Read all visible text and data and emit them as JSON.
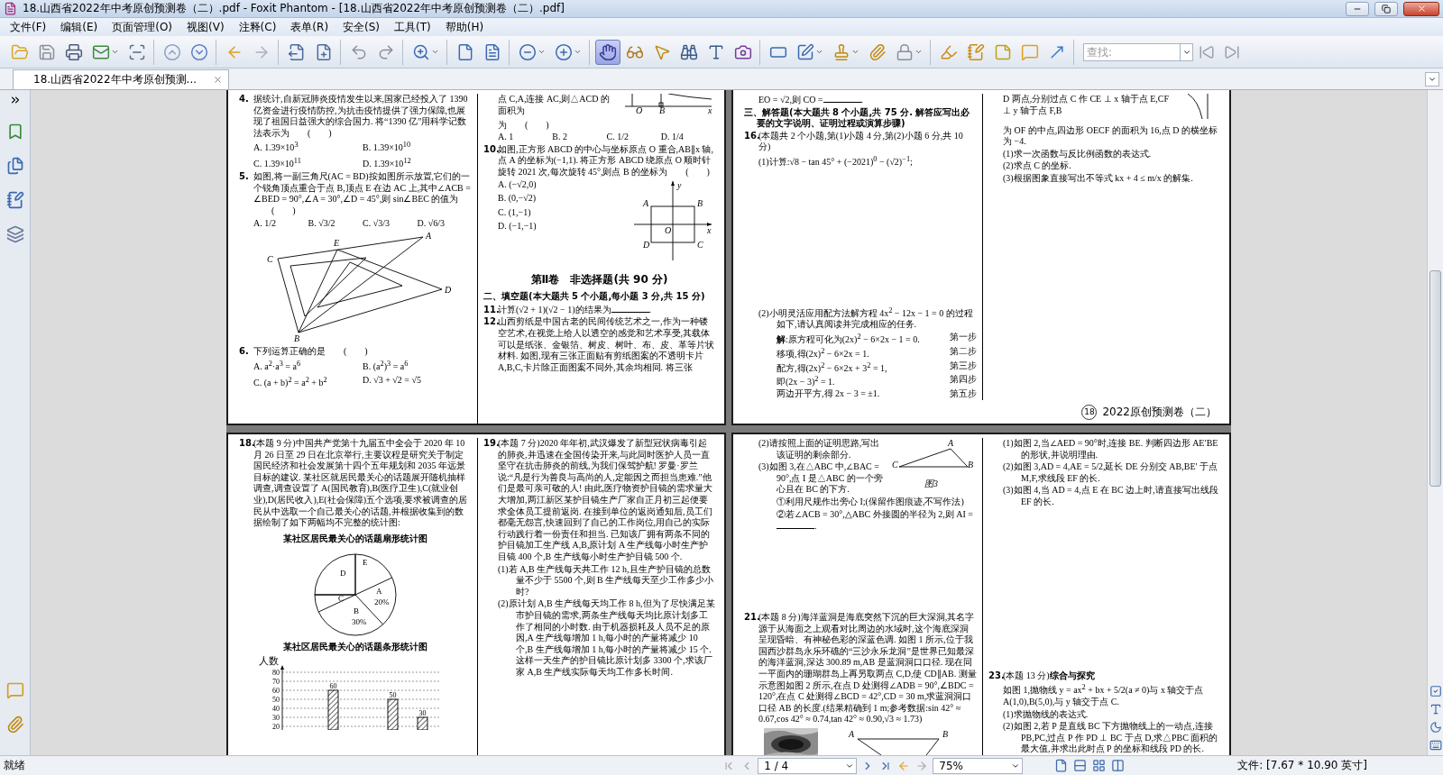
{
  "window": {
    "title": "18.山西省2022年中考原创预测卷（二）.pdf - Foxit Phantom - [18.山西省2022年中考原创预测卷（二）.pdf]"
  },
  "menu": [
    "文件(F)",
    "编辑(E)",
    "页面管理(O)",
    "视图(V)",
    "注释(C)",
    "表单(R)",
    "安全(S)",
    "工具(T)",
    "帮助(H)"
  ],
  "toolbar": [
    [
      {
        "kind": "open",
        "selected": false,
        "menu": false
      },
      {
        "kind": "save",
        "selected": false,
        "menu": false
      },
      {
        "kind": "print",
        "selected": false,
        "menu": false
      },
      {
        "kind": "email",
        "selected": false,
        "menu": true
      },
      {
        "kind": "scan",
        "selected": false,
        "menu": false
      }
    ],
    [
      {
        "kind": "up",
        "selected": false,
        "menu": false
      },
      {
        "kind": "down",
        "selected": false,
        "menu": false
      }
    ],
    [
      {
        "kind": "back",
        "selected": false,
        "menu": false
      },
      {
        "kind": "forward",
        "selected": false,
        "menu": false
      }
    ],
    [
      {
        "kind": "extract",
        "selected": false,
        "menu": false
      },
      {
        "kind": "insert",
        "selected": false,
        "menu": false
      }
    ],
    [
      {
        "kind": "undo",
        "selected": false,
        "menu": false
      },
      {
        "kind": "redo",
        "selected": false,
        "menu": false
      }
    ],
    [
      {
        "kind": "zoom",
        "selected": false,
        "menu": true
      }
    ],
    [
      {
        "kind": "fitpage",
        "selected": false,
        "menu": false
      },
      {
        "kind": "fitwidth",
        "selected": false,
        "menu": false
      }
    ],
    [
      {
        "kind": "zoomout",
        "selected": false,
        "menu": true
      },
      {
        "kind": "zoomin",
        "selected": false,
        "menu": true
      }
    ],
    [
      {
        "kind": "hand",
        "selected": true,
        "menu": false
      },
      {
        "kind": "glasses",
        "selected": false,
        "menu": false
      },
      {
        "kind": "pointer",
        "selected": false,
        "menu": false
      },
      {
        "kind": "binoculars",
        "selected": false,
        "menu": false
      },
      {
        "kind": "typewriter",
        "selected": false,
        "menu": false
      },
      {
        "kind": "camera",
        "selected": false,
        "menu": false
      }
    ],
    [
      {
        "kind": "frame",
        "selected": false,
        "menu": false
      },
      {
        "kind": "edit",
        "selected": false,
        "menu": true
      },
      {
        "kind": "stamp",
        "selected": false,
        "menu": true
      },
      {
        "kind": "attach",
        "selected": false,
        "menu": false
      },
      {
        "kind": "lock",
        "selected": false,
        "menu": true
      }
    ],
    [
      {
        "kind": "highlight",
        "selected": false,
        "menu": false
      },
      {
        "kind": "notebook",
        "selected": false,
        "menu": false
      },
      {
        "kind": "textbox",
        "selected": false,
        "menu": false
      },
      {
        "kind": "comment",
        "selected": false,
        "menu": false
      },
      {
        "kind": "arrow",
        "selected": false,
        "menu": false
      }
    ]
  ],
  "search": {
    "placeholder": "查找:"
  },
  "tabs": [
    {
      "label": "18.山西省2022年中考原创预测...",
      "selected": true
    }
  ],
  "pages": [
    {
      "columns": [
        {
          "blocks": [
            {
              "kind": "question",
              "number": "4.",
              "text": "据统计,自新冠肺炎疫情发生以来,国家已经投入了 1390 亿资金进行疫情防控,为抗击疫情提供了强力保障,也展现了祖国日益强大的综合国力. 将“1390 亿”用科学记数法表示为",
              "bracket": "(　　)"
            },
            {
              "kind": "options-grid",
              "items": [
                "A. 1.39×10$^{3}$",
                "B. 1.39×10$^{10}$",
                "C. 1.39×10$^{11}$",
                "D. 1.39×10$^{12}$"
              ]
            },
            {
              "kind": "question",
              "number": "5.",
              "text": "如图,将一副三角尺(AC = BD)按如图所示放置,它们的一个锐角顶点重合于点 B,顶点 E 在边 AC 上,其中∠ACB = ∠BED = 90°,∠A = 30°,∠D = 45°,则 sin∠BEC 的值为",
              "bracket": "(　　)"
            },
            {
              "kind": "options-row",
              "items": [
                "A. 1/2",
                "B. √3/2",
                "C. √3/3",
                "D. √6/3"
              ]
            },
            {
              "kind": "set-squares",
              "labels": [
                "A",
                "E",
                "C",
                "D",
                "B"
              ]
            },
            {
              "kind": "question",
              "number": "6.",
              "text": "下列运算正确的是",
              "bracket": "(　　)"
            },
            {
              "kind": "options-grid",
              "items": [
                "A. a$^{2}$·a$^{3}$ = a$^{6}$",
                "B. (a$^{2}$)$^{3}$ = a$^{6}$",
                "C. (a + b)$^{2}$ = a$^{2}$ + b$^{2}$",
                "D. √3 + √2 = √5"
              ]
            }
          ]
        },
        {
          "blocks": [
            {
              "kind": "figure-beside",
              "figure": {
                "kind": "axis-fragment",
                "labels": [
                  "O",
                  "B",
                  "x"
                ]
              },
              "blocks": [
                {
                  "kind": "text",
                  "text": "点 C,A,连接 AC,则△ACD 的面积为"
                }
              ]
            },
            {
              "kind": "text",
              "text": "为",
              "bracket": "(　　)"
            },
            {
              "kind": "options-row",
              "items": [
                "A. 1",
                "B. 2",
                "C. 1/2",
                "D. 1/4"
              ]
            },
            {
              "kind": "question",
              "number": "10.",
              "text": "如图,正方形 ABCD 的中心与坐标原点 O 重合,AB∥x 轴,点 A 的坐标为(−1,1). 将正方形 ABCD 绕原点 O 顺时针旋转 2021 次,每次旋转 45°,则点 B 的坐标为",
              "bracket": "(　　)"
            },
            {
              "kind": "options-figure",
              "items": [
                "A. (−√2,0)",
                "B. (0,−√2)",
                "C. (1,−1)",
                "D. (−1,−1)"
              ],
              "figure": {
                "kind": "square-axes",
                "labels": [
                  "y",
                  "A",
                  "B",
                  "O",
                  "x",
                  "D",
                  "C"
                ]
              }
            },
            {
              "kind": "part-title",
              "text": "第Ⅱ卷　非选择题(共 90 分)"
            },
            {
              "kind": "section",
              "text": "二、填空题(本大题共 5 个小题,每小题 3 分,共 15 分)"
            },
            {
              "kind": "question",
              "number": "11.",
              "text": "计算(√2 + 1)(√2 − 1)的结果为",
              "blank": true,
              "after": "."
            },
            {
              "kind": "question",
              "number": "12.",
              "text": "山西剪纸是中国古老的民间传统艺术之一,作为一种镂空艺术,在视觉上给人以透空的感觉和艺术享受,其载体可以是纸张、金银箔、树皮、树叶、布、皮、革等片状材料. 如图,现有三张正面贴有剪纸图案的不透明卡片 A,B,C,卡片除正面图案不同外,其余均相同. 将三张"
            }
          ]
        }
      ]
    },
    {
      "columns": [
        {
          "blocks": [
            {
              "kind": "text",
              "text": "EO = √2,则 CO =",
              "blank": true,
              "after": "."
            },
            {
              "kind": "section",
              "text": "三、解答题(本大题共 8 个小题,共 75 分. 解答应写出必要的文字说明、证明过程或演算步骤)"
            },
            {
              "kind": "question",
              "number": "16.",
              "text": "(本题共 2 个小题,第(1)小题 4 分,第(2)小题 6 分,共 10 分)"
            },
            {
              "kind": "sub",
              "text": "(1)计算:√8 − tan 45° + (−2021)$^{0}$ − (√2)$^{−1}$;",
              "answer_space": true
            },
            {
              "kind": "sub",
              "text": "(2)小明灵活应用配方法解方程 4x$^{2}$ − 12x − 1 = 0 的过程如下,请认真阅读并完成相应的任务."
            },
            {
              "kind": "steps",
              "items": [
                {
                  "text": "**解**:原方程可化为(2x)$^{2}$ − 6×2x − 1 = 0.",
                  "step": "第一步"
                },
                {
                  "text": "移项,得(2x)$^{2}$ − 6×2x = 1.",
                  "step": "第二步"
                },
                {
                  "text": "配方,得(2x)$^{2}$ − 6×2x + 3$^{2}$ = 1,",
                  "step": "第三步"
                },
                {
                  "text": "即(2x − 3)$^{2}$ = 1.",
                  "step": "第四步"
                },
                {
                  "text": "两边开平方,得 2x − 3 = ±1.",
                  "step": "第五步"
                }
              ]
            }
          ]
        },
        {
          "blocks": [
            {
              "kind": "figure-beside",
              "figure": {
                "kind": "curve-fragment"
              },
              "blocks": [
                {
                  "kind": "text",
                  "text": "D 两点,分别过点 C 作 CE ⊥ x 轴于点 E,CF ⊥ y 轴于点 F,B"
                }
              ]
            },
            {
              "kind": "text",
              "text": "为 OF 的中点,四边形 OECF 的面积为 16,点 D 的横坐标为 −4."
            },
            {
              "kind": "text",
              "text": "(1)求一次函数与反比例函数的表达式."
            },
            {
              "kind": "text",
              "text": "(2)求点 C 的坐标."
            },
            {
              "kind": "text",
              "text": "(3)根据图象直接写出不等式 kx + 4 ≤ m/x 的解集."
            }
          ]
        }
      ],
      "footer": {
        "number": "18",
        "title": "2022原创预测卷（二）"
      }
    },
    {
      "columns": [
        {
          "blocks": [
            {
              "kind": "question",
              "number": "18.",
              "text": "(本题 9 分)中国共产党第十九届五中全会于 2020 年 10 月 26 日至 29 日在北京举行,主要议程是研究关于制定国民经济和社会发展第十四个五年规划和 2035 年远景目标的建议. 某社区就居民最关心的话题展开随机抽样调查,调查设置了 A(国民教育),B(医疗卫生),C(就业创业),D(居民收入),E(社会保障)五个选项,要求被调查的居民从中选取一个自己最关心的话题,并根据收集到的数据绘制了如下两幅均不完整的统计图:"
            },
            {
              "kind": "caption",
              "text": "某社区居民最关心的话题扇形统计图"
            },
            {
              "kind": "pie",
              "labels": [
                "E",
                "D",
                "A",
                "C",
                "20%",
                "B",
                "30%"
              ]
            },
            {
              "kind": "chart",
              "chart_data": {
                "type": "bar",
                "title": "某社区居民最关心的话题条形统计图",
                "ylabel": "人数",
                "values": [
                  null,
                  60,
                  null,
                  50,
                  30
                ],
                "ylim": [
                  20,
                  80
                ],
                "yticks": [
                  20,
                  30,
                  40,
                  50,
                  60,
                  70,
                  80
                ],
                "grid": true,
                "data_labels": true
              }
            }
          ]
        },
        {
          "blocks": [
            {
              "kind": "question",
              "number": "19.",
              "text": "(本题 7 分)2020 年年初,武汉爆发了新型冠状病毒引起的肺炎,并迅速在全国传染开来,与此同时医护人员一直坚守在抗击肺炎的前线,为我们保驾护航! 罗曼·罗兰说:“凡是行为善良与高尚的人,定能因之而担当患难.”他们是最可亲可敬的人! 由此,医疗物资护目镜的需求量大大增加,两江新区某护目镜生产厂家自正月初三起便要求全体员工提前返岗. 在接到单位的返岗通知后,员工们都毫无怨言,快速回到了自己的工作岗位,用自己的实际行动践行着一份责任和担当. 已知该厂拥有两条不同的护目镜加工生产线 A,B,原计划 A 生产线每小时生产护目镜 400 个,B 生产线每小时生产护目镜 500 个."
            },
            {
              "kind": "sub",
              "text": "(1)若 A,B 生产线每天共工作 12 h,且生产护目镜的总数量不少于 5500 个,则 B 生产线每天至少工作多少小时?"
            },
            {
              "kind": "sub",
              "text": "(2)原计划 A,B 生产线每天均工作 8 h,但为了尽快满足某市护目镜的需求,两条生产线每天均比原计划多工作了相同的小时数. 由于机器损耗及人员不足的原因,A 生产线每增加 1 h,每小时的产量将减少 10 个,B 生产线每增加 1 h,每小时的产量将减少 15 个. 这样一天生产的护目镜比原计划多 3300 个,求该厂家 A,B 生产线实际每天均工作多长时间."
            }
          ]
        }
      ]
    },
    {
      "columns": [
        {
          "blocks": [
            {
              "kind": "figure-beside",
              "figure": {
                "kind": "right-triangle",
                "labels": [
                  "A",
                  "C",
                  "B",
                  "图3"
                ]
              },
              "blocks": [
                {
                  "kind": "sub",
                  "text": "(2)请按照上面的证明思路,写出该证明的剩余部分."
                },
                {
                  "kind": "sub",
                  "text": "(3)如图 3,在△ABC 中,∠BAC = 90°,点 I 是△ABC 的一个旁心且在 BC 的下方."
                }
              ]
            },
            {
              "kind": "sub2",
              "text": "①利用尺规作出旁心 I;(保留作图痕迹,不写作法)"
            },
            {
              "kind": "sub2",
              "text": "②若∠ACB = 30°,△ABC 外接圆的半径为 2,则 AI =",
              "blank": true,
              "after": ".",
              "answer_space": true
            },
            {
              "kind": "question",
              "number": "21.",
              "text": "(本题 8 分)海洋蓝洞是海底突然下沉的巨大深洞,其名字源于从海面之上观看对比周边的水域时,这个海底深洞呈现昏暗、有神秘色彩的深蓝色调. 如图 1 所示,位于我国西沙群岛永乐环礁的“三沙永乐龙洞”是世界已知最深的海洋蓝洞,深达 300.89 m,AB 是蓝洞洞口口径. 现在同一平面内的珊瑚群岛上再另取两点 C,D,使 CD∥AB. 测量示意图如图 2 所示,在点 D 处测得∠ADB = 90°,∠BDC = 120°,在点 C 处测得∠BCD = 42°,CD = 30 m,求蓝洞洞口口径 AB 的长度.(结果精确到 1 m;参考数据:sin 42° ≈ 0.67,cos 42° ≈ 0.74,tan 42° ≈ 0.90,√3 ≈ 1.73)"
            },
            {
              "kind": "figure-row",
              "items": [
                {
                  "kind": "picture"
                },
                {
                  "kind": "trapezoid",
                  "labels": [
                    "A",
                    "B"
                  ]
                }
              ]
            }
          ]
        },
        {
          "blocks": [
            {
              "kind": "sub",
              "text": "(1)如图 2,当∠AED = 90°时,连接 BE. 判断四边形 AE′BE 的形状,并说明理由."
            },
            {
              "kind": "sub",
              "text": "(2)如图 3,AD = 4,AE = 5/2,延长 DE 分别交 AB,BE′ 于点 M,F,求线段 EF 的长."
            },
            {
              "kind": "sub",
              "text": "(3)如图 4,当 AD = 4,点 E 在 BC 边上时,请直接写出线段 EF 的长.",
              "answer_space": true
            },
            {
              "kind": "question",
              "number": "23.",
              "text": "(本题 13 分)**综合与探究**"
            },
            {
              "kind": "text",
              "text": "如图 1,抛物线 y = ax$^{2}$ + bx + 5/2(a ≠ 0)与 x 轴交于点 A(1,0),B(5,0),与 y 轴交于点 C."
            },
            {
              "kind": "text",
              "text": "(1)求抛物线的表达式."
            },
            {
              "kind": "sub",
              "text": "(2)如图 2,若 P 是直线 BC 下方抛物线上的一动点,连接 PB,PC,过点 P 作 PD ⊥ BC 于点 D,求△PBC 面积的最大值,并求出此时点 P 的坐标和线段 PD 的长."
            }
          ]
        }
      ]
    }
  ],
  "status_bar": {
    "text": "就绪",
    "page": "1 / 4",
    "zoom": "75%",
    "file_size": "文件: [7.67 * 10.90 英寸]"
  }
}
